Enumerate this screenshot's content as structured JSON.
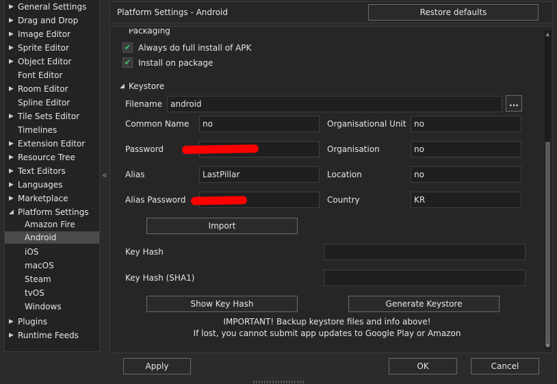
{
  "sidebar": {
    "items": [
      {
        "label": "General Settings",
        "expandable": true
      },
      {
        "label": "Drag and Drop",
        "expandable": true
      },
      {
        "label": "Image Editor",
        "expandable": true
      },
      {
        "label": "Sprite Editor",
        "expandable": true
      },
      {
        "label": "Object Editor",
        "expandable": true
      },
      {
        "label": "Font Editor",
        "expandable": false
      },
      {
        "label": "Room Editor",
        "expandable": true
      },
      {
        "label": "Spline Editor",
        "expandable": false
      },
      {
        "label": "Tile Sets Editor",
        "expandable": true
      },
      {
        "label": "Timelines",
        "expandable": false
      },
      {
        "label": "Extension Editor",
        "expandable": true
      },
      {
        "label": "Resource Tree",
        "expandable": true
      },
      {
        "label": "Text Editors",
        "expandable": true
      },
      {
        "label": "Languages",
        "expandable": true
      },
      {
        "label": "Marketplace",
        "expandable": true
      },
      {
        "label": "Platform Settings",
        "expandable": true,
        "expanded": true
      },
      {
        "label": "Amazon Fire",
        "child": true
      },
      {
        "label": "Android",
        "child": true,
        "selected": true
      },
      {
        "label": "iOS",
        "child": true
      },
      {
        "label": "macOS",
        "child": true
      },
      {
        "label": "Steam",
        "child": true
      },
      {
        "label": "tvOS",
        "child": true
      },
      {
        "label": "Windows",
        "child": true
      },
      {
        "label": "Plugins",
        "expandable": true
      },
      {
        "label": "Runtime Feeds",
        "expandable": true
      }
    ],
    "collapse_glyph": "«"
  },
  "header": {
    "title": "Platform Settings - Android",
    "restore_label": "Restore defaults"
  },
  "packaging": {
    "title": "Packaging",
    "always_full_install": {
      "label": "Always do full install of APK",
      "checked": true
    },
    "install_on_package": {
      "label": "Install on package",
      "checked": true
    }
  },
  "keystore": {
    "title": "Keystore",
    "filename_label": "Filename",
    "filename_value": "android",
    "browse_label": "...",
    "common_name_label": "Common Name",
    "common_name_value": "no",
    "org_unit_label": "Organisational Unit",
    "org_unit_value": "no",
    "password_label": "Password",
    "organisation_label": "Organisation",
    "organisation_value": "no",
    "alias_label": "Alias",
    "alias_value": "LastPillar",
    "location_label": "Location",
    "location_value": "no",
    "alias_password_label": "Alias Password",
    "country_label": "Country",
    "country_value": "KR",
    "import_label": "Import",
    "key_hash_label": "Key Hash",
    "key_hash_value": "",
    "key_hash_sha1_label": "Key Hash (SHA1)",
    "key_hash_sha1_value": "",
    "show_key_hash_label": "Show Key Hash",
    "generate_keystore_label": "Generate Keystore",
    "important_line1": "IMPORTANT! Backup keystore files and info above!",
    "important_line2": "If lost, you cannot submit app updates to Google Play or Amazon"
  },
  "footer": {
    "apply_label": "Apply",
    "ok_label": "OK",
    "cancel_label": "Cancel"
  },
  "colors": {
    "checkmark": "#3fbf6f",
    "redaction": "#ff0000",
    "selected_row": "#4a4a4a"
  }
}
